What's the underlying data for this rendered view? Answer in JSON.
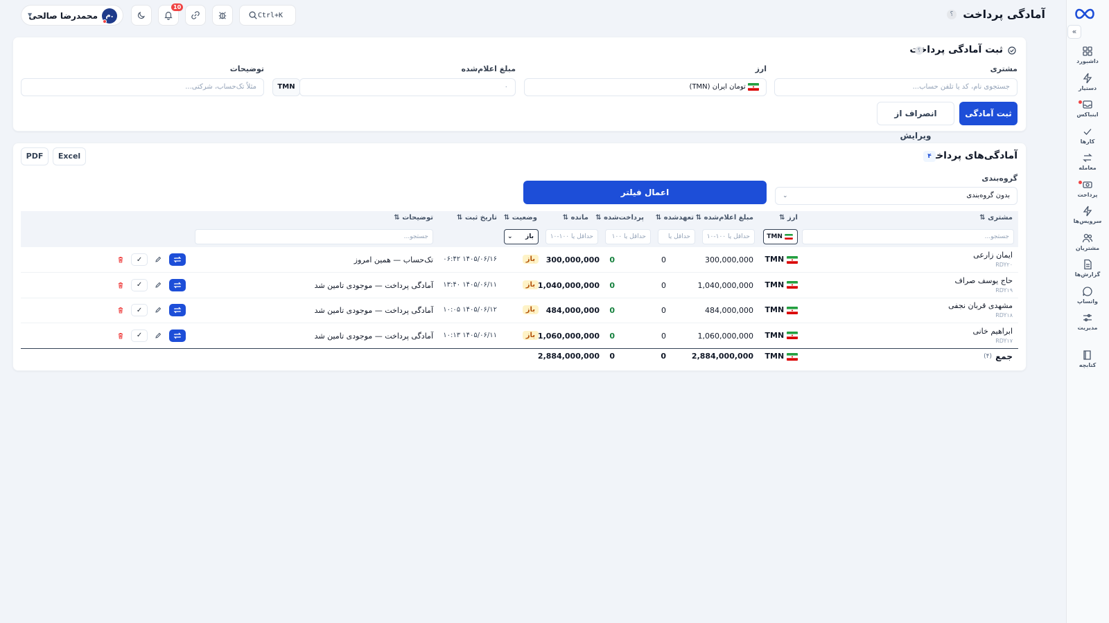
{
  "header": {
    "title": "آمادگی پرداخت",
    "help": "؟",
    "search_shortcut": "Ctrl+K",
    "notifications_count": "10",
    "user_name": "محمدرضا صالحی",
    "user_initial": "م."
  },
  "sidebar": {
    "items": [
      {
        "label": "داشبورد",
        "icon": "dashboard-icon"
      },
      {
        "label": "دستیار",
        "icon": "bolt-icon"
      },
      {
        "label": "اینباکس",
        "icon": "inbox-icon"
      },
      {
        "label": "کارها",
        "icon": "check-icon"
      },
      {
        "label": "معامله",
        "icon": "exchange-icon"
      },
      {
        "label": "پرداخت",
        "icon": "payment-icon"
      },
      {
        "label": "سرویس‌ها",
        "icon": "services-icon"
      },
      {
        "label": "مشتریان",
        "icon": "users-icon"
      },
      {
        "label": "گزارش‌ها",
        "icon": "report-icon"
      },
      {
        "label": "واتساپ",
        "icon": "chat-icon"
      },
      {
        "label": "مدیریت",
        "icon": "settings-sliders-icon"
      },
      {
        "label": "کتابچه",
        "icon": "book-icon"
      }
    ]
  },
  "form": {
    "title": "ثبت آمادگی پرداخت",
    "help": "؟",
    "customer_label": "مشتری",
    "customer_placeholder": "جستجوی نام، کد یا تلفن حساب...",
    "currency_label": "ارز",
    "currency_value": "تومان ایران (TMN)",
    "amount_label": "مبلغ اعلام‌شده",
    "amount_placeholder": "۰",
    "amount_unit": "TMN",
    "notes_label": "توضیحات",
    "notes_placeholder": "مثلاً تک‌حساب، شرکتی...",
    "submit_label": "ثبت آمادگی",
    "cancel_label": "انصراف از ویرایش"
  },
  "list": {
    "title": "آمادگی‌های پرداخت",
    "count": "۴",
    "export_excel": "Excel",
    "export_pdf": "PDF",
    "grouping_label": "گروه‌بندی",
    "grouping_value": "بدون گروه‌بندی",
    "apply_filter": "اعمال فیلتر",
    "columns": {
      "customer": "مشتری",
      "currency": "ارز",
      "declared": "مبلغ اعلام‌شده",
      "committed": "تعهدشده",
      "paid": "پرداخت‌شده",
      "remaining": "مانده",
      "status": "وضعیت",
      "date": "تاریخ ثبت",
      "notes": "توضیحات"
    },
    "filters": {
      "customer": "جستجو...",
      "currency": "TMN",
      "declared": "حداقل یا ۱۰۰-۱۰",
      "committed": "حداقل یا",
      "paid": "حداقل یا ۱۰۰",
      "remaining": "حداقل یا ۱۰۰-۱۰",
      "status": "باز",
      "notes": "جستجو..."
    },
    "rows": [
      {
        "name": "ایمان زارعی",
        "code": "RDY۲۰",
        "currency": "TMN",
        "declared": "300,000,000",
        "committed": "0",
        "paid": "0",
        "remaining": "300,000,000",
        "status": "باز",
        "date": "۱۴۰۵/۰۶/۱۶ ۰۶:۴۲",
        "notes": "تک‌حساب — همین امروز"
      },
      {
        "name": "حاج یوسف صراف",
        "code": "RDY۱۹",
        "currency": "TMN",
        "declared": "1,040,000,000",
        "committed": "0",
        "paid": "0",
        "remaining": "1,040,000,000",
        "status": "باز",
        "date": "۱۴۰۵/۰۶/۱۱ ۱۳:۴۰",
        "notes": "آمادگی پرداخت — موجودی تامین شد"
      },
      {
        "name": "مشهدی قربان نجفی",
        "code": "RDY۱۸",
        "currency": "TMN",
        "declared": "484,000,000",
        "committed": "0",
        "paid": "0",
        "remaining": "484,000,000",
        "status": "باز",
        "date": "۱۴۰۵/۰۶/۱۲ ۱۰:۰۵",
        "notes": "آمادگی پرداخت — موجودی تامین شد"
      },
      {
        "name": "ابراهیم خانی",
        "code": "RDY۱۷",
        "currency": "TMN",
        "declared": "1,060,000,000",
        "committed": "0",
        "paid": "0",
        "remaining": "1,060,000,000",
        "status": "باز",
        "date": "۱۴۰۵/۰۶/۱۱ ۱۰:۱۳",
        "notes": "آمادگی پرداخت — موجودی تامین شد"
      }
    ],
    "total": {
      "label": "جمع",
      "count": "(۴)",
      "currency": "TMN",
      "declared": "2,884,000,000",
      "committed": "0",
      "paid": "0",
      "remaining": "2,884,000,000"
    }
  },
  "colors": {
    "primary": "#1d4ed8",
    "status_open_bg": "#fef3c7",
    "status_open_fg": "#b45309",
    "danger": "#ef4444"
  }
}
